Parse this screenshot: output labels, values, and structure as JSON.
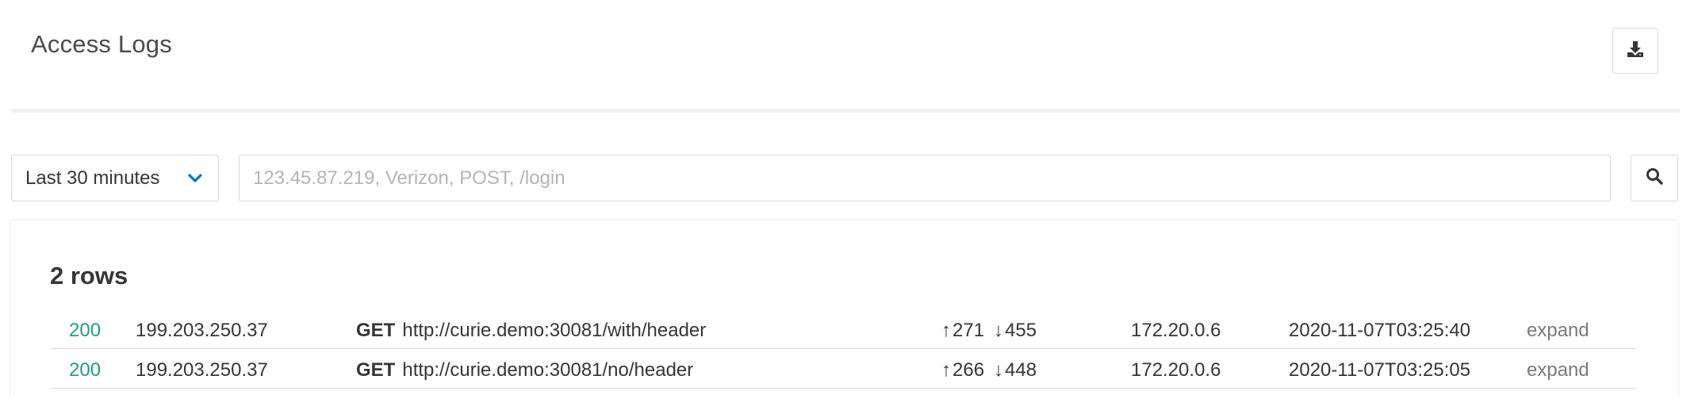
{
  "header": {
    "title": "Access Logs",
    "download_icon": "download-icon"
  },
  "filters": {
    "time_range": "Last 30 minutes",
    "chevron_icon": "chevron-down-icon",
    "search_placeholder": "123.45.87.219, Verizon, POST, /login",
    "search_value": "",
    "search_icon": "search-icon",
    "accent_color": "#0075d6"
  },
  "results": {
    "count_label": "2 rows",
    "rows": [
      {
        "status": "200",
        "client_ip": "199.203.250.37",
        "method": "GET",
        "url": "http://curie.demo:30081/with/header",
        "up_arrow": "↑",
        "bytes_up": "271",
        "down_arrow": "↓",
        "bytes_down": "455",
        "upstream": "172.20.0.6",
        "timestamp": "2020-11-07T03:25:40",
        "expand_label": "expand"
      },
      {
        "status": "200",
        "client_ip": "199.203.250.37",
        "method": "GET",
        "url": "http://curie.demo:30081/no/header",
        "up_arrow": "↑",
        "bytes_up": "266",
        "down_arrow": "↓",
        "bytes_down": "448",
        "upstream": "172.20.0.6",
        "timestamp": "2020-11-07T03:25:05",
        "expand_label": "expand"
      }
    ],
    "status_color": "#1e9e88"
  }
}
